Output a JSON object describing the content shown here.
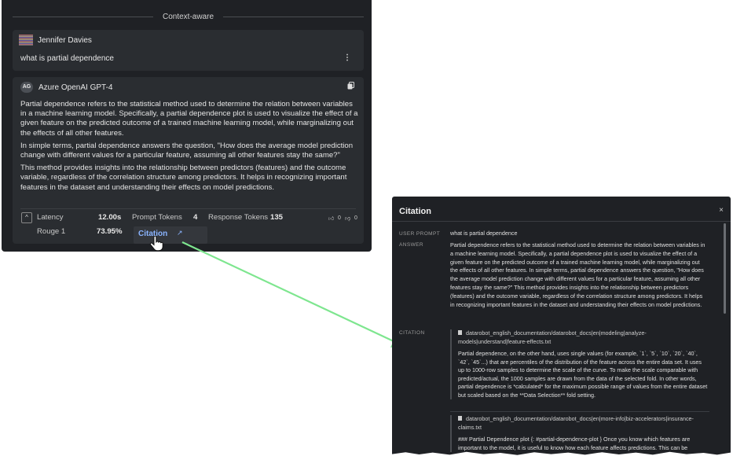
{
  "chat": {
    "divider_label": "Context-aware",
    "user": {
      "name": "Jennifer Davies",
      "message": "what is partial dependence",
      "menu_glyph": "⋮"
    },
    "assistant": {
      "badge": "AG",
      "model_name": "Azure OpenAI GPT-4",
      "paragraphs": [
        "Partial dependence refers to the statistical method used to determine the relation between variables in a machine learning model. Specifically, a partial dependence plot is used to visualize the effect of a given feature on the predicted outcome of a trained machine learning model, while marginalizing out the effects of all other features.",
        "In simple terms, partial dependence answers the question, \"How does the average model prediction change with different values for a particular feature, assuming all other features stay the same?\"",
        "This method provides insights into the relationship between predictors (features) and the outcome variable, regardless of the correlation structure among predictors. It helps in recognizing important features in the dataset and understanding their effects on model predictions."
      ]
    },
    "metrics": {
      "latency_label": "Latency",
      "latency_value": "12.00s",
      "prompt_tokens_label": "Prompt Tokens",
      "prompt_tokens_value": "4",
      "response_tokens_label": "Response Tokens",
      "response_tokens_value": "135",
      "rouge_label": "Rouge 1",
      "rouge_value": "73.95%",
      "thumbs_up_count": "0",
      "thumbs_down_count": "0",
      "citation_label": "Citation"
    }
  },
  "citation_panel": {
    "title": "Citation",
    "close_glyph": "×",
    "user_prompt_label": "USER PROMPT",
    "user_prompt": "what is partial dependence",
    "answer_label": "ANSWER",
    "answer": "Partial dependence refers to the statistical method used to determine the relation between variables in a machine learning model. Specifically, a partial dependence plot is used to visualize the effect of a given feature on the predicted outcome of a trained machine learning model, while marginalizing out the effects of all other features. In simple terms, partial dependence answers the question, \"How does the average model prediction change with different values for a particular feature, assuming all other features stay the same?\" This method provides insights into the relationship between predictors (features) and the outcome variable, regardless of the correlation structure among predictors. It helps in recognizing important features in the dataset and understanding their effects on model predictions.",
    "citation_label": "CITATION",
    "citations": [
      {
        "file": "datarobot_english_documentation/datarobot_docs|en|modeling|analyze-models|understand|feature-effects.txt",
        "text": "Partial dependence, on the other hand, uses single values (for example, `1`, `5`, `10`, `20`, `40`, `42`, `45`...) that are percentiles of the distribution of the feature across the entire data set. It uses up to 1000-row samples to determine the scale of the curve. To make the scale comparable with predicted/actual, the 1000 samples are drawn from the data of the selected fold. In other words, partial dependence is *calculated* for the maximum possible range of values from the entire dataset but scaled based on the **Data Selection** fold setting."
      },
      {
        "file": "datarobot_english_documentation/datarobot_docs|en|more-info|biz-accelerators|insurance-claims.txt",
        "text": "### Partial Dependence plot {: #partial-dependence-plot } Once you know which features are important to the model, it is useful to know how each feature affects predictions. This can be"
      }
    ]
  },
  "colors": {
    "panel_bg": "#1f2125",
    "card_bg": "#2a2d31",
    "link": "#8ab4ff",
    "arrow": "#7ee68f"
  }
}
